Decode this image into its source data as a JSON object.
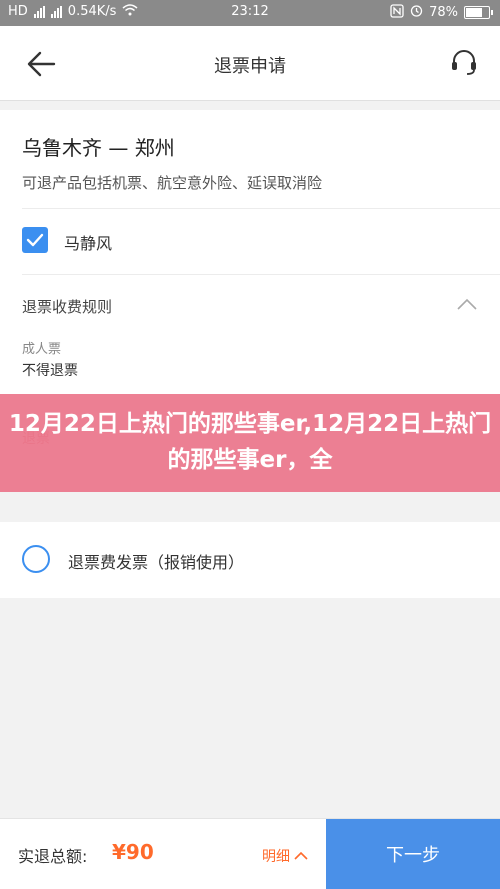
{
  "status_bar": {
    "carrier_icons": "HD",
    "network_speed": "0.54K/s",
    "time": "23:12",
    "battery_percent": "78%",
    "battery_level": 0.78
  },
  "header": {
    "title": "退票申请"
  },
  "trip": {
    "route": "乌鲁木齐 — 郑州",
    "refund_note": "可退产品包括机票、航空意外险、延误取消险"
  },
  "passenger": {
    "name": "马静风",
    "checked": true
  },
  "rules": {
    "title": "退票收费规则",
    "category": "成人票",
    "value": "不得退票",
    "ghost_label": "退票"
  },
  "banner": {
    "text": "12月22日上热门的那些事er,12月22日上热门的那些事er，全"
  },
  "invoice": {
    "label": "退票费发票（报销使用）",
    "selected": false
  },
  "bottom_bar": {
    "total_label": "实退总额:",
    "total_amount": "¥90",
    "detail_label": "明细",
    "next_label": "下一步"
  },
  "colors": {
    "accent": "#4a90e8",
    "price": "#ff6a2b",
    "banner": "#ec768c"
  }
}
